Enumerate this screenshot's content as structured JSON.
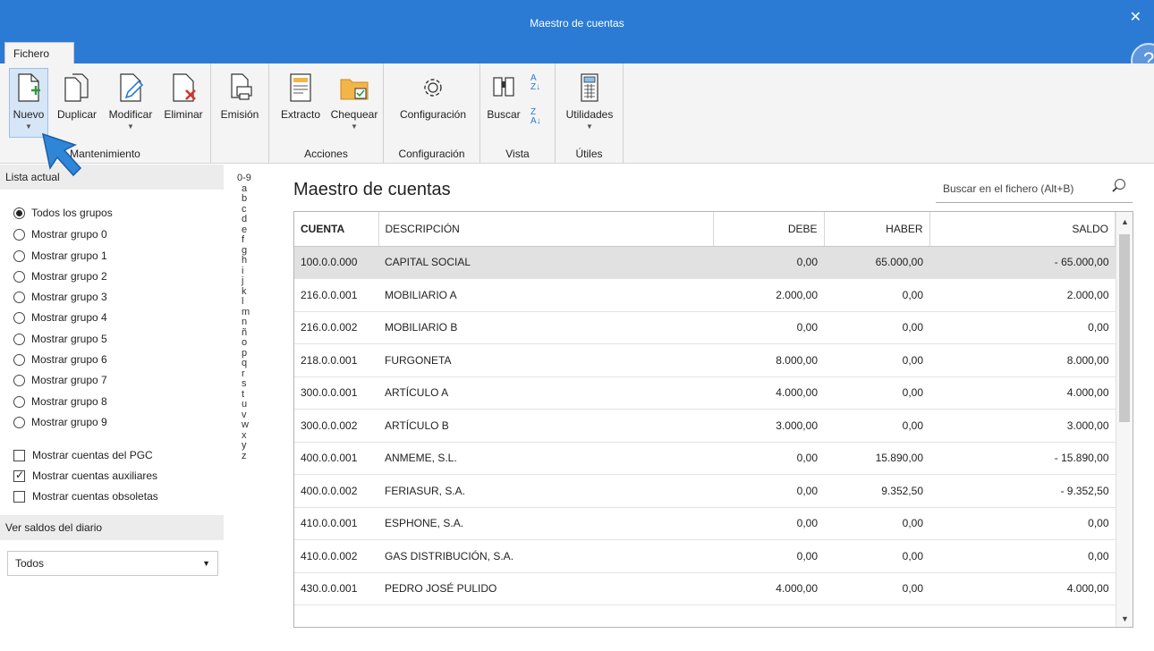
{
  "window": {
    "title": "Maestro de cuentas",
    "close_glyph": "✕",
    "help_glyph": "?"
  },
  "ribbon_tab": "Fichero",
  "ribbon": {
    "groups": [
      {
        "label": "Mantenimiento",
        "buttons": [
          "Nuevo",
          "Duplicar",
          "Modificar",
          "Eliminar"
        ]
      },
      {
        "label": "",
        "buttons": [
          "Emisión"
        ]
      },
      {
        "label": "Acciones",
        "buttons": [
          "Extracto",
          "Chequear"
        ]
      },
      {
        "label": "Configuración",
        "buttons": [
          "Configuración"
        ]
      },
      {
        "label": "Vista",
        "buttons": [
          "Buscar"
        ]
      },
      {
        "label": "Útiles",
        "buttons": [
          "Utilidades"
        ]
      }
    ]
  },
  "left": {
    "lista_actual": "Lista actual",
    "groups": [
      "Todos los grupos",
      "Mostrar grupo 0",
      "Mostrar grupo 1",
      "Mostrar grupo 2",
      "Mostrar grupo 3",
      "Mostrar grupo 4",
      "Mostrar grupo 5",
      "Mostrar grupo 6",
      "Mostrar grupo 7",
      "Mostrar grupo 8",
      "Mostrar grupo 9"
    ],
    "checks": [
      "Mostrar cuentas del PGC",
      "Mostrar cuentas auxiliares",
      "Mostrar cuentas obsoletas"
    ],
    "ver_saldos": "Ver saldos del diario",
    "select_value": "Todos"
  },
  "alpha_index": [
    "0-9",
    "a",
    "b",
    "c",
    "d",
    "e",
    "f",
    "g",
    "h",
    "i",
    "j",
    "k",
    "l",
    "m",
    "n",
    "ñ",
    "o",
    "p",
    "q",
    "r",
    "s",
    "t",
    "u",
    "v",
    "w",
    "x",
    "y",
    "z"
  ],
  "main": {
    "title": "Maestro de cuentas",
    "search_placeholder": "Buscar en el fichero (Alt+B)",
    "columns": [
      "CUENTA",
      "DESCRIPCIÓN",
      "DEBE",
      "HABER",
      "SALDO"
    ],
    "rows": [
      [
        "100.0.0.000",
        "CAPITAL SOCIAL",
        "0,00",
        "65.000,00",
        "- 65.000,00"
      ],
      [
        "216.0.0.001",
        "MOBILIARIO A",
        "2.000,00",
        "0,00",
        "2.000,00"
      ],
      [
        "216.0.0.002",
        "MOBILIARIO B",
        "0,00",
        "0,00",
        "0,00"
      ],
      [
        "218.0.0.001",
        "FURGONETA",
        "8.000,00",
        "0,00",
        "8.000,00"
      ],
      [
        "300.0.0.001",
        "ARTÍCULO A",
        "4.000,00",
        "0,00",
        "4.000,00"
      ],
      [
        "300.0.0.002",
        "ARTÍCULO B",
        "3.000,00",
        "0,00",
        "3.000,00"
      ],
      [
        "400.0.0.001",
        "ANMEME, S.L.",
        "0,00",
        "15.890,00",
        "- 15.890,00"
      ],
      [
        "400.0.0.002",
        "FERIASUR, S.A.",
        "0,00",
        "9.352,50",
        "- 9.352,50"
      ],
      [
        "410.0.0.001",
        "ESPHONE, S.A.",
        "0,00",
        "0,00",
        "0,00"
      ],
      [
        "410.0.0.002",
        "GAS DISTRIBUCIÓN, S.A.",
        "0,00",
        "0,00",
        "0,00"
      ],
      [
        "430.0.0.001",
        "PEDRO JOSÉ PULIDO",
        "4.000,00",
        "0,00",
        "4.000,00"
      ]
    ]
  }
}
